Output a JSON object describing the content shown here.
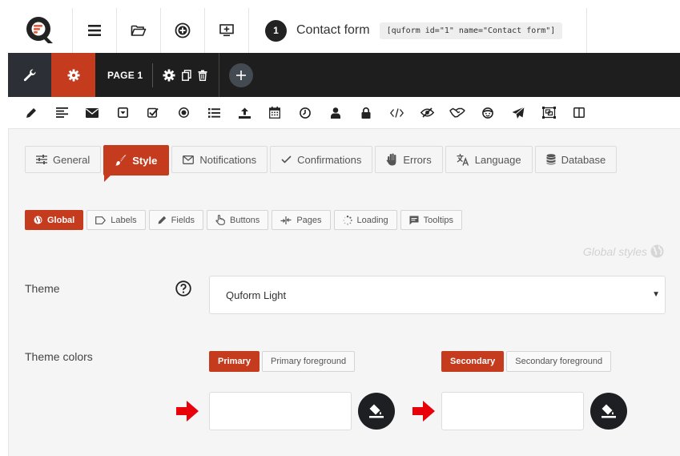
{
  "header": {
    "form_number": "1",
    "form_name": "Contact form",
    "shortcode": "[quform id=\"1\" name=\"Contact form\"]",
    "buttons": [
      "menu-icon",
      "folder-open-icon",
      "add-circle-icon",
      "preview-icon"
    ]
  },
  "pagebar": {
    "page_label": "PAGE 1"
  },
  "tabs": [
    {
      "label": "General",
      "icon": "sliders-icon"
    },
    {
      "label": "Style",
      "icon": "brush-icon"
    },
    {
      "label": "Notifications",
      "icon": "envelope-icon"
    },
    {
      "label": "Confirmations",
      "icon": "check-icon"
    },
    {
      "label": "Errors",
      "icon": "hand-icon"
    },
    {
      "label": "Language",
      "icon": "translate-icon"
    },
    {
      "label": "Database",
      "icon": "database-icon"
    }
  ],
  "subtabs": [
    {
      "label": "Global",
      "icon": "globe-icon"
    },
    {
      "label": "Labels",
      "icon": "tag-icon"
    },
    {
      "label": "Fields",
      "icon": "pencil-icon"
    },
    {
      "label": "Buttons",
      "icon": "pointer-icon"
    },
    {
      "label": "Pages",
      "icon": "pages-icon"
    },
    {
      "label": "Loading",
      "icon": "spinner-icon"
    },
    {
      "label": "Tooltips",
      "icon": "comment-icon"
    }
  ],
  "section": {
    "title": "Global styles"
  },
  "theme": {
    "label": "Theme",
    "value": "Quform Light"
  },
  "theme_colors": {
    "label": "Theme colors",
    "primary_tab": "Primary",
    "primary_fg_tab": "Primary foreground",
    "secondary_tab": "Secondary",
    "secondary_fg_tab": "Secondary foreground",
    "primary_value": "",
    "secondary_value": ""
  },
  "colors": {
    "accent": "#c43b1d",
    "dark": "#1e1e1e"
  }
}
